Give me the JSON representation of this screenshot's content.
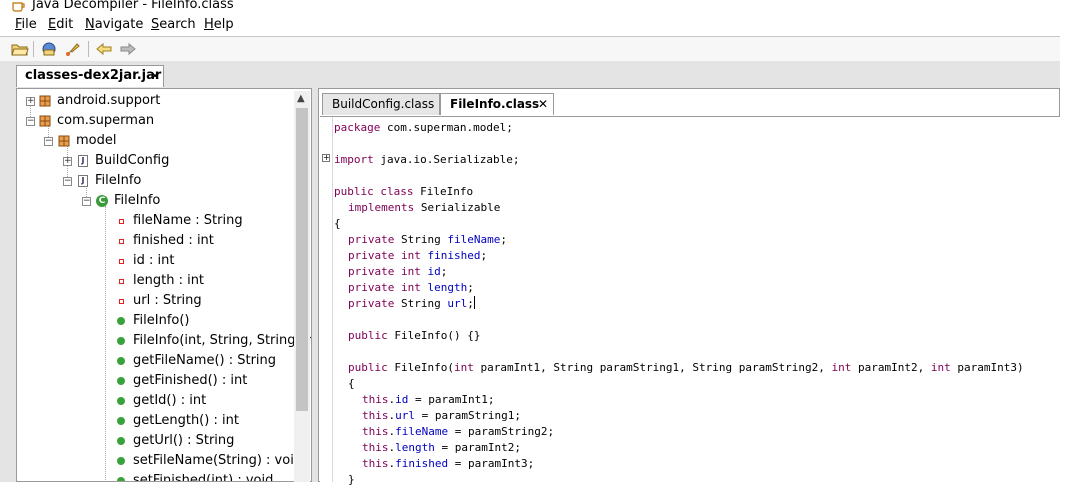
{
  "window": {
    "title": "Java Decompiler - FileInfo.class"
  },
  "menubar": {
    "items": [
      "File",
      "Edit",
      "Navigate",
      "Search",
      "Help"
    ],
    "underline": [
      "F",
      "E",
      "N",
      "S",
      "H"
    ]
  },
  "toolbar": {
    "icons": [
      "open-folder-icon",
      "open-type-icon",
      "launch-icon",
      "back-icon",
      "forward-icon"
    ]
  },
  "jar_tab": {
    "label": "classes-dex2jar.jar",
    "close": "✕"
  },
  "tree": {
    "rows": [
      {
        "label": "android.support",
        "kind": "package"
      },
      {
        "label": "com.superman",
        "kind": "package"
      },
      {
        "label": "model",
        "kind": "package"
      },
      {
        "label": "BuildConfig",
        "kind": "file"
      },
      {
        "label": "FileInfo",
        "kind": "file"
      },
      {
        "label": "FileInfo",
        "kind": "class"
      },
      {
        "label": "fileName : String",
        "kind": "field"
      },
      {
        "label": "finished : int",
        "kind": "field"
      },
      {
        "label": "id : int",
        "kind": "field"
      },
      {
        "label": "length : int",
        "kind": "field"
      },
      {
        "label": "url : String",
        "kind": "field"
      },
      {
        "label": "FileInfo()",
        "kind": "method"
      },
      {
        "label": "FileInfo(int, String, String, int",
        "kind": "method"
      },
      {
        "label": "getFileName() : String",
        "kind": "method"
      },
      {
        "label": "getFinished() : int",
        "kind": "method"
      },
      {
        "label": "getId() : int",
        "kind": "method"
      },
      {
        "label": "getLength() : int",
        "kind": "method"
      },
      {
        "label": "getUrl() : String",
        "kind": "method"
      },
      {
        "label": "setFileName(String) : void",
        "kind": "method"
      },
      {
        "label": "setFinished(int) : void",
        "kind": "method"
      }
    ]
  },
  "editor_tabs": [
    {
      "label": "BuildConfig.class",
      "active": false
    },
    {
      "label": "FileInfo.class",
      "active": true,
      "close": "✕"
    }
  ],
  "code": {
    "l1_kw": "package",
    "l1_rest": " com.superman.model;",
    "l2_kw": "import",
    "l2_rest": " java.io.Serializable;",
    "l3_kw": "public class",
    "l3_rest": " FileInfo",
    "l4_kw": "implements",
    "l4_rest": " Serializable",
    "l5": "{",
    "f1_kw": "private",
    "f1_type": " String ",
    "f1_name": "fileName",
    "f1_end": ";",
    "f2_kw": "private int",
    "f2_name": " finished",
    "f2_end": ";",
    "f3_kw": "private int",
    "f3_name": " id",
    "f3_end": ";",
    "f4_kw": "private int",
    "f4_name": " length",
    "f4_end": ";",
    "f5_kw": "private",
    "f5_type": " String ",
    "f5_name": "url",
    "f5_end": ";",
    "c1_kw": "public",
    "c1_rest": " FileInfo() {}",
    "c2_kw": "public",
    "c2_a": " FileInfo(",
    "c2_int1": "int",
    "c2_b": " paramInt1, String paramString1, String paramString2, ",
    "c2_int2": "int",
    "c2_c": " paramInt2, ",
    "c2_int3": "int",
    "c2_d": " paramInt3)",
    "c2_open": "{",
    "a1_this": "this",
    "a1_dot": ".",
    "a1_f": "id",
    "a1_rest": " = paramInt1;",
    "a2_this": "this",
    "a2_dot": ".",
    "a2_f": "url",
    "a2_rest": " = paramString1;",
    "a3_this": "this",
    "a3_dot": ".",
    "a3_f": "fileName",
    "a3_rest": " = paramString2;",
    "a4_this": "this",
    "a4_dot": ".",
    "a4_f": "length",
    "a4_rest": " = paramInt2;",
    "a5_this": "this",
    "a5_dot": ".",
    "a5_f": "finished",
    "a5_rest": " = paramInt3;",
    "close": "}"
  },
  "colors": {
    "keyword": "#7f0055",
    "field": "#0000c0",
    "method_icon": "#3aa23a",
    "field_icon": "#dd2222"
  }
}
